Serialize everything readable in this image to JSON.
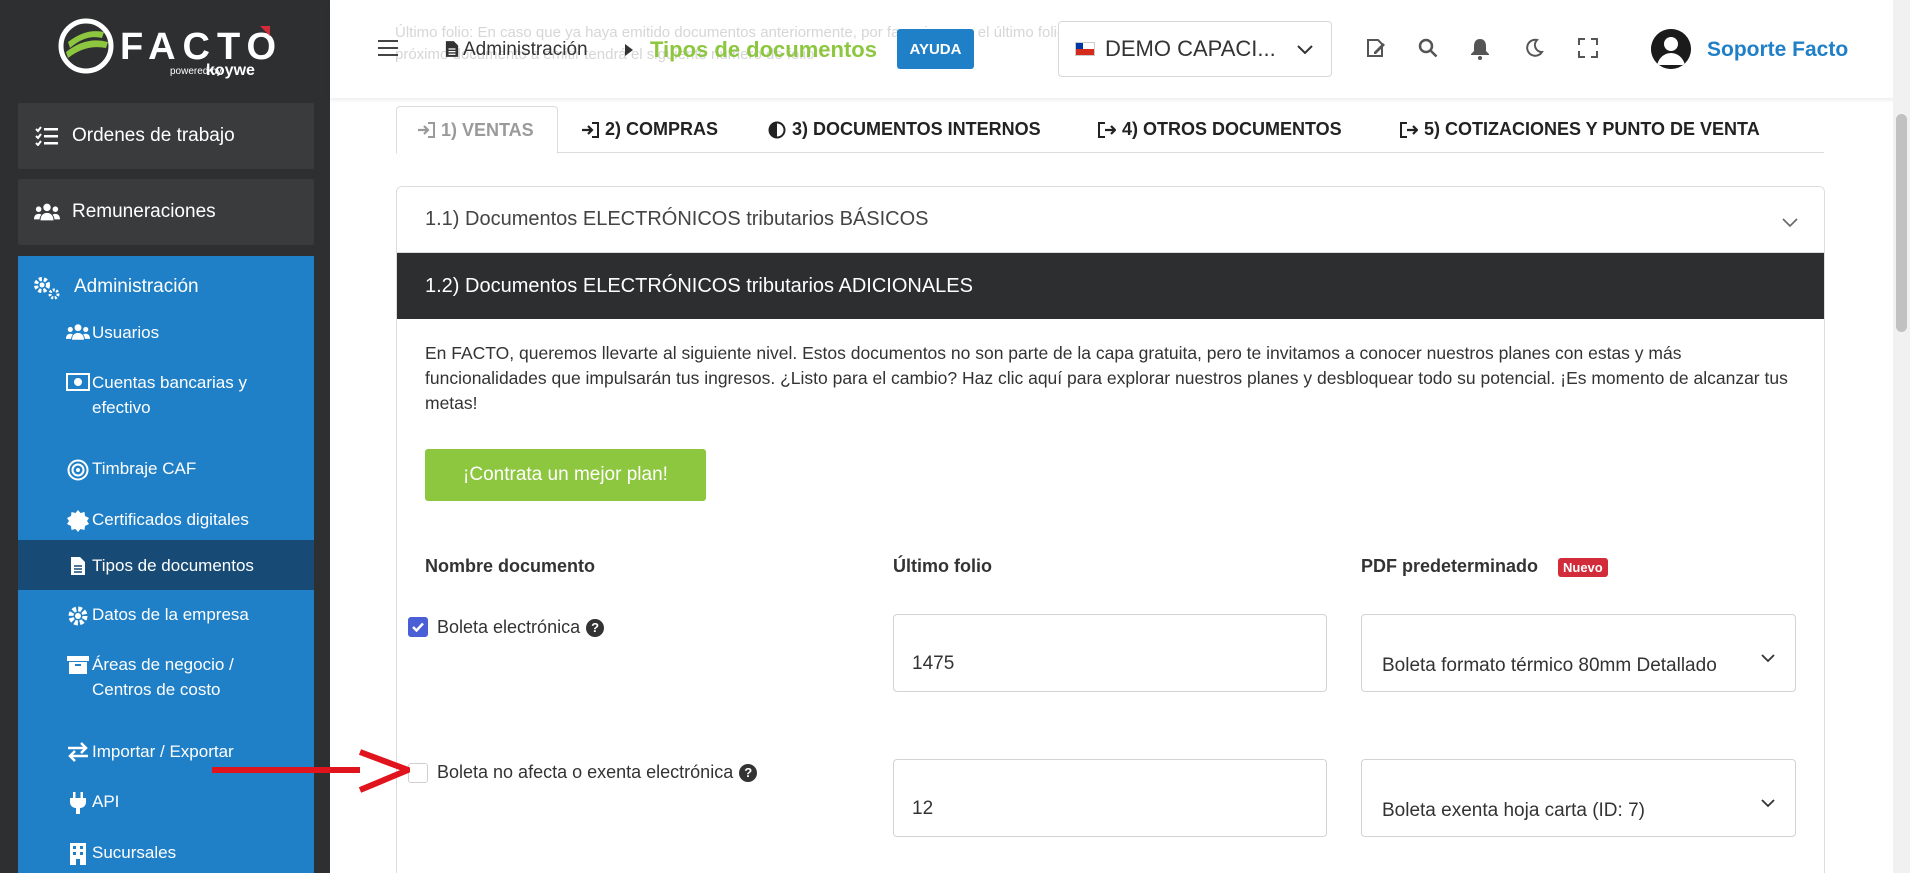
{
  "app": {
    "brand": "FACTO",
    "powered_by": "powered by",
    "brand_partner": "koywe"
  },
  "sidebar": {
    "top_items": [
      {
        "label": "Ordenes de trabajo",
        "icon": "list-check-icon"
      },
      {
        "label": "Remuneraciones",
        "icon": "users-icon"
      }
    ],
    "section": {
      "label": "Administración",
      "icon": "cogs-icon"
    },
    "sub_items": [
      {
        "label": "Usuarios",
        "icon": "users-icon"
      },
      {
        "label": "Cuentas bancarias y efectivo",
        "icon": "money-icon"
      },
      {
        "label": "Timbraje CAF",
        "icon": "bullseye-icon"
      },
      {
        "label": "Certificados digitales",
        "icon": "certificate-icon"
      },
      {
        "label": "Tipos de documentos",
        "icon": "file-icon",
        "active": true
      },
      {
        "label": "Datos de la empresa",
        "icon": "gear-icon"
      },
      {
        "label": "Áreas de negocio / Centros de costo",
        "icon": "archive-icon"
      },
      {
        "label": "Importar / Exportar",
        "icon": "exchange-icon"
      },
      {
        "label": "API",
        "icon": "plug-icon"
      },
      {
        "label": "Sucursales",
        "icon": "building-icon"
      }
    ]
  },
  "header": {
    "breadcrumb_parent": "Administración",
    "breadcrumb_current": "Tipos de documentos",
    "help_label": "AYUDA",
    "company_selector": "DEMO CAPACI...",
    "user_name": "Soporte Facto",
    "icons": [
      "edit-icon",
      "search-icon",
      "bell-icon",
      "moon-icon",
      "expand-icon"
    ]
  },
  "tabs": [
    {
      "label": "1) VENTAS",
      "active": true
    },
    {
      "label": "2) COMPRAS"
    },
    {
      "label": "3) DOCUMENTOS INTERNOS"
    },
    {
      "label": "4) OTROS DOCUMENTOS"
    },
    {
      "label": "5) COTIZACIONES Y PUNTO DE VENTA"
    }
  ],
  "accordion": {
    "item1_title": "1.1) Documentos ELECTRÓNICOS tributarios BÁSICOS",
    "item2_title": "1.2) Documentos ELECTRÓNICOS tributarios ADICIONALES",
    "intro_text": "En FACTO, queremos llevarte al siguiente nivel. Estos documentos no son parte de la capa gratuita, pero te invitamos a conocer nuestros planes con estas y más funcionalidades que impulsarán tus ingresos. ¿Listo para el cambio? Haz clic aquí para explorar nuestros planes y desbloquear todo su potencial. ¡Es momento de alcanzar tus metas!",
    "cta_label": "¡Contrata un mejor plan!"
  },
  "table": {
    "col_name": "Nombre documento",
    "col_folio": "Último folio",
    "col_pdf": "PDF predeterminado",
    "new_badge": "Nuevo",
    "rows": [
      {
        "name": "Boleta electrónica",
        "checked": true,
        "folio": "1475",
        "pdf": "Boleta formato térmico 80mm Detallado"
      },
      {
        "name": "Boleta no afecta o exenta electrónica",
        "checked": false,
        "folio": "12",
        "pdf": "Boleta exenta hoja carta (ID: 7)"
      }
    ]
  },
  "background_text": "Último folio: En caso que ya haya emitido documentos anteriormente, por favor ingrese el último folio emitido. El próximo documento a emitir tendrá el siguiente número de folio",
  "colors": {
    "sidebar_bg": "#2e2f31",
    "primary_blue": "#1f7fc7",
    "active_item": "#174a75",
    "accent_green": "#8dc63f",
    "badge_red": "#d22b3a",
    "checkbox_blue": "#4a5fd6",
    "annotation_arrow": "#e0141c"
  }
}
